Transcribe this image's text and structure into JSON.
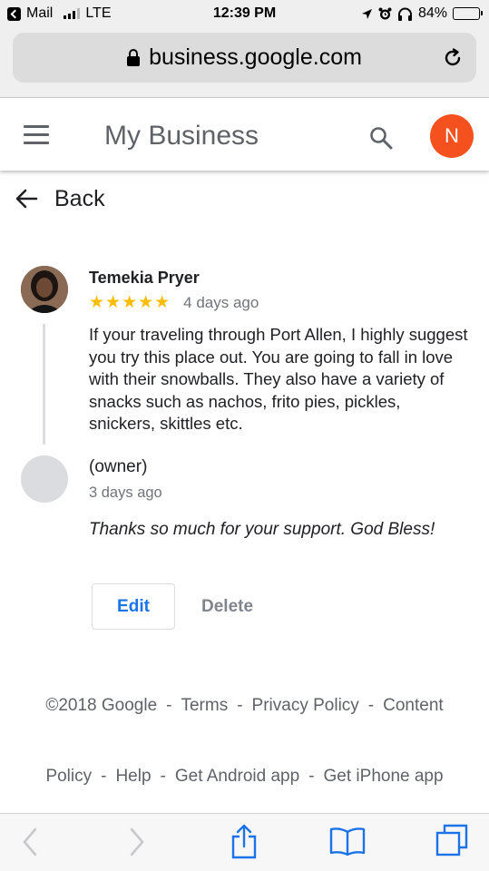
{
  "status_bar": {
    "back_app": "Mail",
    "network": "LTE",
    "time": "12:39 PM",
    "battery": "84%",
    "battery_level": 0.84
  },
  "browser": {
    "url": "business.google.com"
  },
  "header": {
    "title": "My Business",
    "avatar_letter": "N"
  },
  "nav": {
    "back_label": "Back"
  },
  "review": {
    "reviewer_name": "Temekia Pryer",
    "stars": "★★★★★",
    "rating": 5,
    "date": "4 days ago",
    "text": "If your traveling through Port Allen, I highly suggest you try this place out. You are going to fall in love with their snowballs. They also have a variety of snacks such as nachos, frito pies, pickles, snickers, skittles etc."
  },
  "reply": {
    "author": "(owner)",
    "date": "3 days ago",
    "text": "Thanks so much for your support. God Bless!"
  },
  "actions": {
    "edit_label": "Edit",
    "delete_label": "Delete"
  },
  "footer": {
    "copyright": "©2018 Google",
    "sep": "-",
    "terms": "Terms",
    "privacy": "Privacy Policy",
    "content": "Content",
    "policy": "Policy",
    "help": "Help",
    "android": "Get Android app",
    "iphone": "Get iPhone app"
  },
  "colors": {
    "accent": "#1a73e8",
    "avatar_bg": "#f4511e",
    "star": "#fbbc04"
  }
}
